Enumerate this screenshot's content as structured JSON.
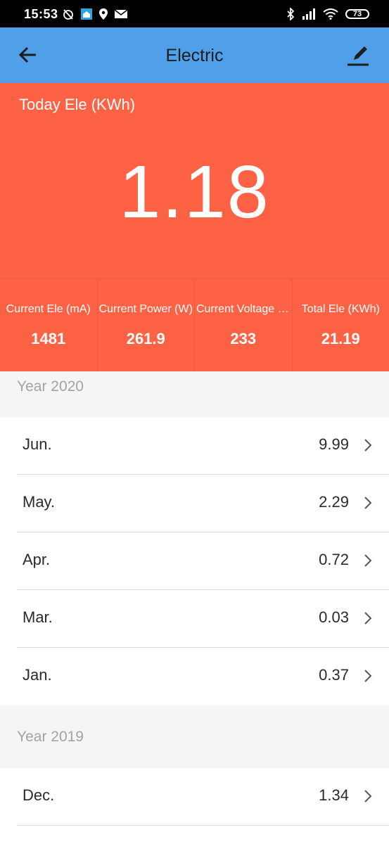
{
  "status_bar": {
    "time": "15:53",
    "battery": "73",
    "icons_left": [
      "alarm-off-icon",
      "app-notification-icon",
      "location-icon",
      "mail-icon"
    ],
    "icons_right": [
      "bluetooth-icon",
      "signal-icon",
      "wifi-icon",
      "battery-icon"
    ]
  },
  "app_bar": {
    "title": "Electric",
    "back_icon": "back-arrow-icon",
    "edit_icon": "edit-icon"
  },
  "hero": {
    "label": "Today Ele (KWh)",
    "value": "1.18"
  },
  "stats": [
    {
      "label": "Current Ele (mA)",
      "value": "1481"
    },
    {
      "label": "Current Power (W)",
      "value": "261.9"
    },
    {
      "label": "Current Voltage (V)",
      "value": "233"
    },
    {
      "label": "Total Ele (KWh)",
      "value": "21.19"
    }
  ],
  "years": [
    {
      "label": "Year 2020",
      "months": [
        {
          "name": "Jun.",
          "value": "9.99"
        },
        {
          "name": "May.",
          "value": "2.29"
        },
        {
          "name": "Apr.",
          "value": "0.72"
        },
        {
          "name": "Mar.",
          "value": "0.03"
        },
        {
          "name": "Jan.",
          "value": "0.37"
        }
      ]
    },
    {
      "label": "Year 2019",
      "months": [
        {
          "name": "Dec.",
          "value": "1.34"
        }
      ]
    }
  ],
  "colors": {
    "app_bar": "#4fa0e9",
    "hero": "#fe6244",
    "section_bg": "#f5f5f5"
  }
}
